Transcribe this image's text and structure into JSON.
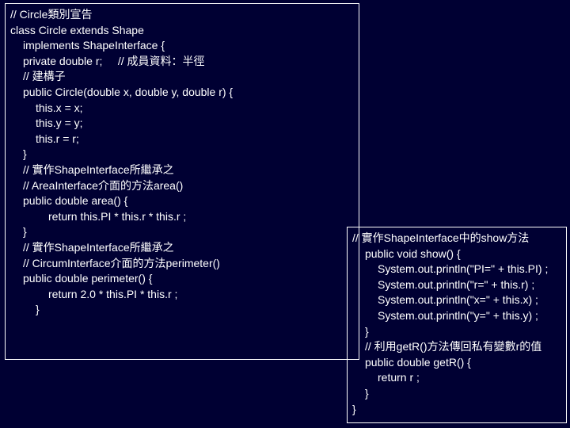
{
  "box1": {
    "l1": "// Circle類別宣告",
    "l2": "class Circle extends Shape",
    "l3": "implements ShapeInterface {",
    "l4": "private double r;     // 成員資料：半徑",
    "l5": "// 建構子",
    "l6": "public Circle(double x, double y, double r) {",
    "l7": "this.x = x;",
    "l8": "this.y = y;",
    "l9": "this.r = r;",
    "l10": "}",
    "l11": "// 實作ShapeInterface所繼承之",
    "l12": "// AreaInterface介面的方法area()",
    "l13": "public double area() {",
    "l14": "return this.PI * this.r * this.r ;",
    "l15": "}",
    "l16": "// 實作ShapeInterface所繼承之",
    "l17": "// CircumInterface介面的方法perimeter()",
    "l18": "public double perimeter() {",
    "l19": "return 2.0 * this.PI * this.r ;",
    "l20": "}"
  },
  "box2": {
    "l1": "// 實作ShapeInterface中的show方法",
    "l2": "public void show() {",
    "l3": "System.out.println(\"PI=\" + this.PI) ;",
    "l4": "System.out.println(\"r=\" + this.r) ;",
    "l5": "System.out.println(\"x=\" + this.x) ;",
    "l6": "System.out.println(\"y=\" + this.y) ;",
    "l7": "}",
    "l8": "// 利用getR()方法傳回私有變數r的值",
    "l9": "public double getR() {",
    "l10": "return r ;",
    "l11": "}",
    "l12": "}"
  }
}
